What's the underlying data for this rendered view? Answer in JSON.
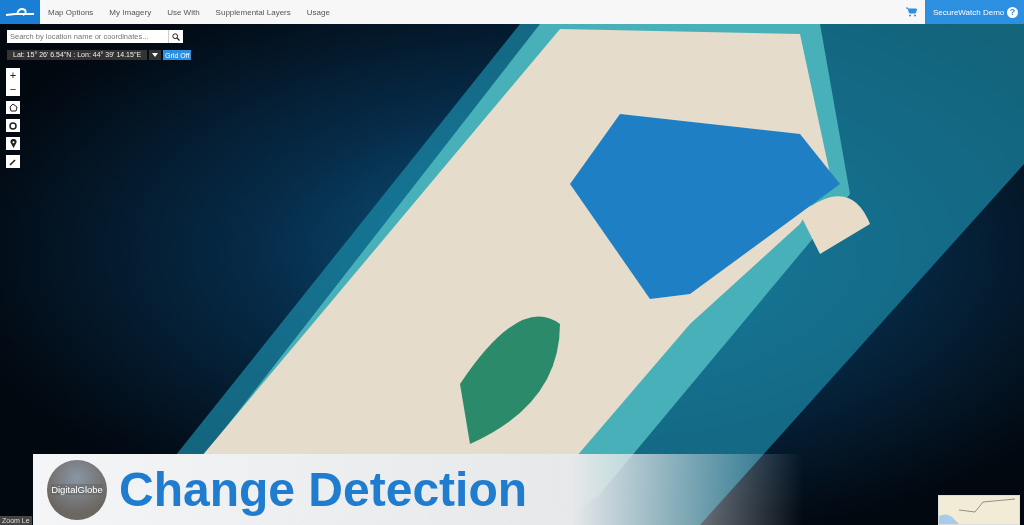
{
  "nav": {
    "items": [
      {
        "label": "Map Options"
      },
      {
        "label": "My Imagery"
      },
      {
        "label": "Use With"
      },
      {
        "label": "Supplemental Layers"
      },
      {
        "label": "Usage"
      }
    ],
    "account": "SecureWatch Demo",
    "help": "?"
  },
  "search": {
    "placeholder": "Search by location name or coordinates..."
  },
  "coordinates": {
    "text": "Lat: 15° 26' 6.54\"N : Lon: 44° 39' 14.15\"E",
    "grid_button": "Grid Off"
  },
  "zoom": {
    "in": "+",
    "out": "−"
  },
  "zoom_label": "Zoom Le",
  "banner": {
    "logo_text": "DigitalGlobe",
    "title": "Change Detection"
  }
}
